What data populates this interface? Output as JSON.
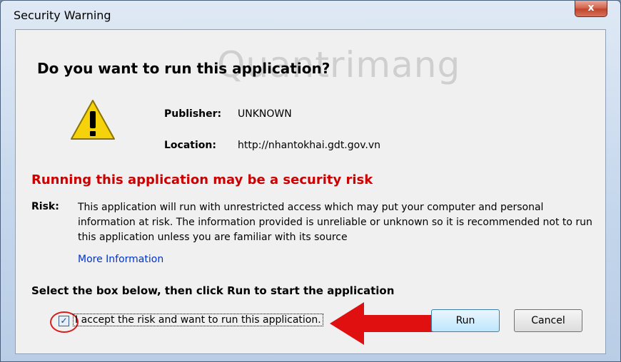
{
  "window": {
    "title": "Security Warning",
    "close_glyph": "x"
  },
  "dialog": {
    "heading": "Do you want to run this application?",
    "watermark": "Quantrimang",
    "icon": "warning-triangle-icon",
    "publisher_label": "Publisher:",
    "publisher_value": "UNKNOWN",
    "location_label": "Location:",
    "location_value": "http://nhantokhai.gdt.gov.vn",
    "risk_heading": "Running this application may be a security risk",
    "risk_label": "Risk:",
    "risk_text": "This application will run with unrestricted access which may put your computer and personal information at risk. The information provided is unreliable or unknown so it is recommended not to run this application unless you are familiar with its source",
    "more_info": "More Information",
    "instruction": "Select the box below, then click Run to start the application",
    "accept_label": "I accept the risk and want to run this application.",
    "accept_checked": true,
    "checkbox_glyph": "✓",
    "run_label": "Run",
    "cancel_label": "Cancel"
  },
  "annotations": {
    "arrow_color": "#e01010",
    "circle_color": "#d81e1e"
  }
}
